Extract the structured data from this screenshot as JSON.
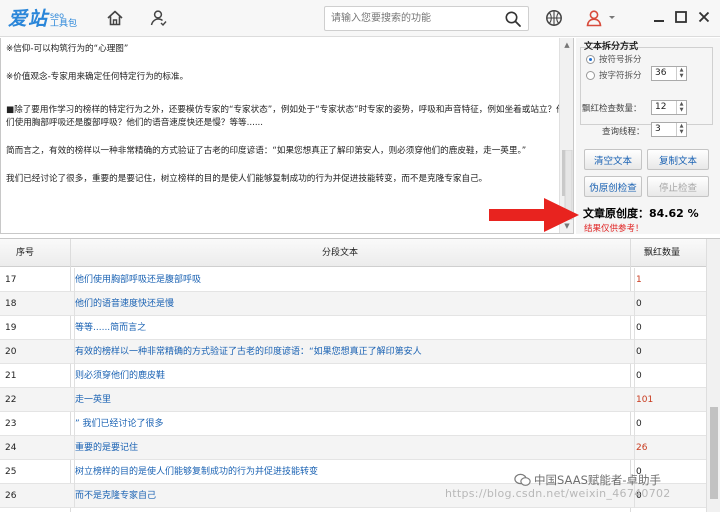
{
  "app": {
    "logo_main": "爱站",
    "logo_seo": "seo",
    "logo_tool": "工具包",
    "search_placeholder": "请输入您要搜索的功能"
  },
  "icons": {
    "home": "home-icon",
    "users": "user-icon",
    "search": "search-icon",
    "ball": "basketball-icon",
    "account": "account-icon",
    "minimize": "minimize-icon",
    "maximize": "maximize-icon",
    "close": "close-icon"
  },
  "text_area": {
    "paragraphs": [
      "※信仰-可以构筑行为的“心理图”",
      "※价值观念-专家用来确定任何特定行为的标准。",
      "■除了要用作学习的榜样的特定行为之外，还要模仿专家的“专家状态”，例如处于“专家状态”时专家的姿势，呼吸和声音特征，例如坐着或站立？他们使用胸部呼吸还是腹部呼吸？他们的语音速度快还是慢？等等......",
      "简而言之，有效的榜样以一种非常精确的方式验证了古老的印度谚语：“如果您想真正了解印第安人，则必须穿他们的鹿皮鞋，走一英里。”",
      "我们已经讨论了很多，重要的是要记住，树立榜样的目的是使人们能够复制成功的行为并促进技能转变，而不是克隆专家自己。"
    ]
  },
  "split_panel": {
    "title": "文本拆分方式",
    "option1": "按符号拆分",
    "option2": "按字符拆分",
    "char_count": "36",
    "check_count_label": "飘红检查数量：",
    "check_count": "12",
    "threads_label": "查询线程：",
    "threads": "3"
  },
  "buttons": {
    "clear": "清空文本",
    "copy": "复制文本",
    "pseudo_check": "伪原创检查",
    "stop": "停止检查"
  },
  "result": {
    "originality": "文章原创度：84.62 %",
    "note": "结果仅供参考！"
  },
  "table": {
    "headers": {
      "index": "序号",
      "text": "分段文本",
      "count": "飘红数量"
    },
    "rows": [
      {
        "index": "17",
        "text": "他们使用胸部呼吸还是腹部呼吸",
        "count": "1"
      },
      {
        "index": "18",
        "text": "他们的语音速度快还是慢",
        "count": "0"
      },
      {
        "index": "19",
        "text": "等等......简而言之",
        "count": "0"
      },
      {
        "index": "20",
        "text": "有效的榜样以一种非常精确的方式验证了古老的印度谚语：“如果您想真正了解印第安人",
        "count": "0"
      },
      {
        "index": "21",
        "text": "则必须穿他们的鹿皮鞋",
        "count": "0"
      },
      {
        "index": "22",
        "text": "走一英里",
        "count": "101"
      },
      {
        "index": "23",
        "text": "” 我们已经讨论了很多",
        "count": "0"
      },
      {
        "index": "24",
        "text": "重要的是要记住",
        "count": "26"
      },
      {
        "index": "25",
        "text": "树立榜样的目的是使人们能够复制成功的行为并促进技能转变",
        "count": "0"
      },
      {
        "index": "26",
        "text": "而不是克隆专家自己",
        "count": "0"
      }
    ]
  },
  "watermark": {
    "wechat": "中国SAAS赋能者-卓助手",
    "url": "https://blog.csdn.net/weixin_46740702"
  },
  "colors": {
    "brand_blue": "#2a86d9",
    "link_blue": "#1a62b3",
    "alert_red": "#e02020",
    "count_red": "#c83a1e"
  }
}
